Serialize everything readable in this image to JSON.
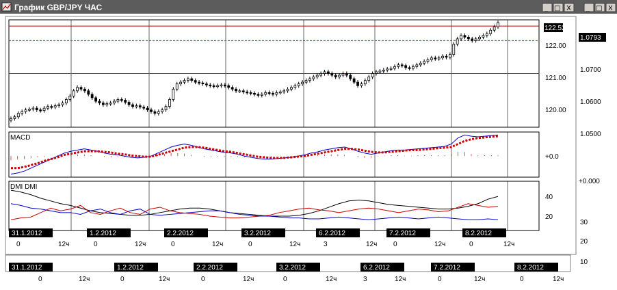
{
  "window": {
    "title": "График GBP/JPY ЧАС",
    "controls": {
      "minimize": "_",
      "maximize": "□",
      "close": "X"
    }
  },
  "outer_controls": {
    "minimize": "_",
    "maximize": "□",
    "close": "X"
  },
  "colors": {
    "title_bar": "#4a4a4a",
    "price_candle": "#000000",
    "resistance_line": "#c00000",
    "support_line": "#008000",
    "signal_line": "#cc0000",
    "macd_line": "#0000cc",
    "dmi_plus": "#cc0000",
    "dmi_minus": "#0000cc",
    "adx": "#000000"
  },
  "price_panel": {
    "current_price_tag": "122.52",
    "y_ticks": [
      "122.00",
      "121.00",
      "120.00"
    ]
  },
  "right_scale": {
    "current_tag": "1.0793",
    "ticks": [
      "1.0700",
      "1.0600",
      "1.0500",
      "+0.000"
    ]
  },
  "macd_panel": {
    "label": "MACD",
    "zero_tick": "+0.0"
  },
  "dmi_panel": {
    "label": "DMI DMI",
    "ticks": [
      "40",
      "20"
    ]
  },
  "right_dmi_ticks": [
    "30",
    "20",
    "10"
  ],
  "dates_front": [
    {
      "date": "31.1.2012",
      "hours": [
        "0",
        "12"
      ]
    },
    {
      "date": "1.2.2012",
      "hours": [
        "0",
        "12"
      ]
    },
    {
      "date": "2.2.2012",
      "hours": [
        "0",
        "12"
      ]
    },
    {
      "date": "3.2.2012",
      "hours": [
        "0",
        "12"
      ]
    },
    {
      "date": "6.2.2012",
      "hours": [
        "3",
        "12"
      ]
    },
    {
      "date": "7.2.2012",
      "hours": [
        "0",
        "12"
      ]
    },
    {
      "date": "8.2.2012",
      "hours": [
        "0",
        "12"
      ]
    }
  ],
  "dates_back": [
    {
      "date": "31.1.2012",
      "hours": [
        "0",
        "12"
      ]
    },
    {
      "date": "1.2.2012",
      "hours": [
        "0",
        "12"
      ]
    },
    {
      "date": "2.2.2012",
      "hours": [
        "0",
        "12"
      ]
    },
    {
      "date": "3.2.2012",
      "hours": [
        "0",
        "12"
      ]
    },
    {
      "date": "6.2.2012",
      "hours": [
        "3",
        "12"
      ]
    },
    {
      "date": "7.2.2012",
      "hours": [
        "0",
        "12"
      ]
    },
    {
      "date": "8.2.2012",
      "hours": [
        "0",
        "12"
      ]
    }
  ],
  "hour_suffix": "ч",
  "chart_data": {
    "type": "candlestick",
    "title": "График GBP/JPY ЧАС",
    "ylim": [
      119.5,
      122.6
    ],
    "horizontal_levels": [
      {
        "value": 122.42,
        "color": "#c00000"
      },
      {
        "value": 122.0,
        "color": "#008000",
        "style": "dashed"
      },
      {
        "value": 121.05,
        "color": "#008000"
      }
    ],
    "close": [
      119.75,
      119.8,
      119.9,
      119.95,
      120.0,
      120.02,
      120.05,
      120.0,
      119.98,
      120.05,
      120.1,
      120.08,
      120.12,
      120.15,
      120.2,
      120.3,
      120.4,
      120.55,
      120.65,
      120.6,
      120.55,
      120.45,
      120.35,
      120.25,
      120.2,
      120.15,
      120.18,
      120.2,
      120.25,
      120.3,
      120.28,
      120.22,
      120.15,
      120.1,
      120.12,
      120.08,
      120.05,
      120.0,
      119.95,
      119.9,
      119.95,
      120.0,
      120.1,
      120.3,
      120.6,
      120.75,
      120.8,
      120.85,
      120.9,
      120.85,
      120.8,
      120.78,
      120.75,
      120.72,
      120.7,
      120.68,
      120.7,
      120.72,
      120.7,
      120.65,
      120.6,
      120.55,
      120.55,
      120.52,
      120.5,
      120.48,
      120.45,
      120.42,
      120.45,
      120.5,
      120.48,
      120.45,
      120.5,
      120.52,
      120.55,
      120.6,
      120.65,
      120.7,
      120.75,
      120.8,
      120.85,
      120.9,
      120.95,
      121.0,
      121.05,
      121.1,
      121.05,
      121.0,
      120.95,
      121.0,
      121.05,
      121.0,
      120.9,
      120.8,
      120.7,
      120.75,
      120.85,
      120.95,
      121.05,
      121.1,
      121.12,
      121.15,
      121.18,
      121.2,
      121.25,
      121.3,
      121.28,
      121.22,
      121.2,
      121.25,
      121.3,
      121.35,
      121.4,
      121.45,
      121.5,
      121.48,
      121.5,
      121.55,
      121.52,
      121.6,
      121.9,
      122.05,
      122.15,
      122.1,
      122.05,
      122.0,
      122.05,
      122.1,
      122.15,
      122.2,
      122.3,
      122.4,
      122.52
    ],
    "macd": {
      "macd_line": [
        -0.3,
        -0.28,
        -0.25,
        -0.2,
        -0.15,
        -0.1,
        -0.05,
        0.0,
        0.05,
        0.08,
        0.1,
        0.12,
        0.1,
        0.08,
        0.05,
        0.03,
        0.02,
        0.0,
        -0.02,
        -0.03,
        -0.02,
        0.0,
        0.05,
        0.1,
        0.15,
        0.18,
        0.2,
        0.18,
        0.15,
        0.12,
        0.1,
        0.08,
        0.06,
        0.05,
        0.03,
        0.0,
        -0.02,
        -0.04,
        -0.05,
        -0.05,
        -0.04,
        -0.03,
        -0.02,
        0.0,
        0.02,
        0.05,
        0.07,
        0.1,
        0.12,
        0.14,
        0.15,
        0.12,
        0.08,
        0.05,
        0.03,
        0.05,
        0.07,
        0.09,
        0.1,
        0.1,
        0.11,
        0.12,
        0.13,
        0.14,
        0.15,
        0.16,
        0.2,
        0.3,
        0.35,
        0.33,
        0.32,
        0.33,
        0.34,
        0.35
      ],
      "signal_line": [
        -0.2,
        -0.2,
        -0.18,
        -0.15,
        -0.12,
        -0.08,
        -0.05,
        -0.02,
        0.02,
        0.04,
        0.06,
        0.08,
        0.08,
        0.08,
        0.07,
        0.06,
        0.04,
        0.03,
        0.01,
        0.0,
        -0.01,
        -0.01,
        0.02,
        0.05,
        0.08,
        0.11,
        0.14,
        0.15,
        0.15,
        0.14,
        0.12,
        0.1,
        0.08,
        0.07,
        0.05,
        0.03,
        0.01,
        -0.01,
        -0.02,
        -0.03,
        -0.03,
        -0.03,
        -0.02,
        -0.01,
        0.0,
        0.02,
        0.04,
        0.06,
        0.08,
        0.1,
        0.12,
        0.12,
        0.11,
        0.09,
        0.07,
        0.06,
        0.06,
        0.07,
        0.08,
        0.09,
        0.1,
        0.1,
        0.11,
        0.12,
        0.13,
        0.14,
        0.15,
        0.2,
        0.25,
        0.28,
        0.3,
        0.31,
        0.32,
        0.33
      ]
    },
    "dmi": {
      "adx": [
        45,
        43,
        40,
        36,
        33,
        30,
        28,
        25,
        22,
        20,
        19,
        18,
        17,
        17,
        18,
        20,
        22,
        24,
        25,
        25,
        24,
        22,
        20,
        19,
        18,
        17,
        16,
        16,
        16,
        17,
        19,
        22,
        26,
        30,
        33,
        34,
        33,
        31,
        29,
        28,
        27,
        26,
        25,
        24,
        24,
        25,
        27,
        30,
        35,
        38
      ],
      "plus_di": [
        12,
        14,
        15,
        20,
        25,
        22,
        24,
        28,
        20,
        18,
        22,
        25,
        20,
        18,
        24,
        26,
        22,
        20,
        19,
        18,
        16,
        15,
        14,
        14,
        15,
        16,
        17,
        20,
        22,
        24,
        25,
        23,
        22,
        20,
        22,
        24,
        25,
        24,
        22,
        20,
        22,
        24,
        23,
        21,
        22,
        26,
        30,
        28,
        26,
        27
      ],
      "minus_di": [
        30,
        28,
        25,
        24,
        22,
        20,
        20,
        18,
        22,
        24,
        20,
        18,
        22,
        24,
        18,
        17,
        18,
        19,
        20,
        21,
        22,
        22,
        20,
        18,
        17,
        16,
        16,
        15,
        14,
        14,
        13,
        13,
        14,
        15,
        14,
        13,
        12,
        13,
        14,
        15,
        14,
        13,
        14,
        15,
        14,
        13,
        12,
        12,
        13,
        12
      ]
    }
  }
}
